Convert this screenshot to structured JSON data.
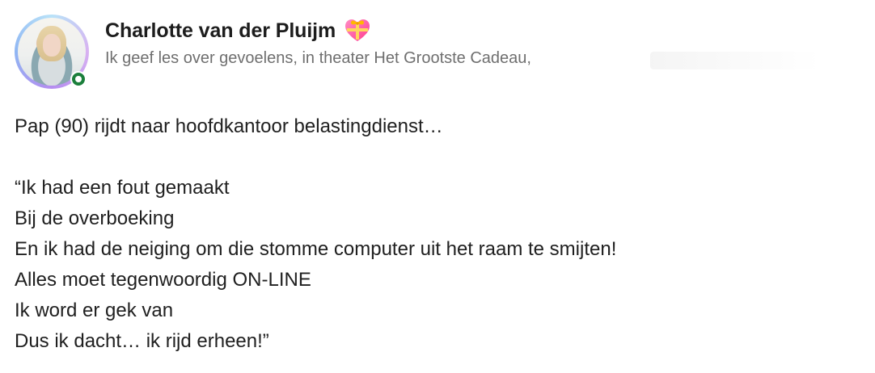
{
  "author": {
    "name": "Charlotte van der Pluijm",
    "subtitle": "Ik geef les over gevoelens, in theater Het Grootste Cadeau,",
    "status": "online"
  },
  "post": {
    "lines": [
      "Pap (90) rijdt naar hoofdkantoor belastingdienst…",
      "",
      "“Ik had een fout gemaakt",
      "Bij de overboeking",
      "En ik had de neiging om die stomme computer uit het raam te smijten!",
      "Alles moet tegenwoordig ON-LINE",
      "Ik word er gek van",
      "Dus ik dacht… ik rijd erheen!”"
    ]
  },
  "icons": {
    "avatar": "profile-photo",
    "status": "online-dot-icon",
    "emoji": "gift-heart-icon"
  },
  "colors": {
    "online": "#1b7f3b",
    "name": "#1d1d1d",
    "subtitle": "#6f6f6f",
    "text": "#202020"
  }
}
